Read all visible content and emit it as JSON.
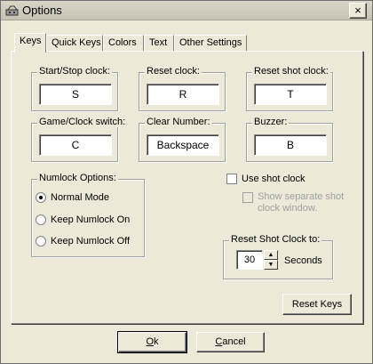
{
  "window": {
    "title": "Options",
    "close_glyph": "×",
    "icon": "options-icon"
  },
  "tabs": [
    {
      "label": "Keys",
      "active": true
    },
    {
      "label": "Quick Keys",
      "active": false
    },
    {
      "label": "Colors",
      "active": false
    },
    {
      "label": "Text",
      "active": false
    },
    {
      "label": "Other Settings",
      "active": false
    }
  ],
  "keys": {
    "start_stop": {
      "label": "Start/Stop clock:",
      "value": "S"
    },
    "reset_clock": {
      "label": "Reset clock:",
      "value": "R"
    },
    "reset_shot": {
      "label": "Reset shot clock:",
      "value": "T"
    },
    "game_clock": {
      "label": "Game/Clock switch:",
      "value": "C"
    },
    "clear_number": {
      "label": "Clear Number:",
      "value": "Backspace"
    },
    "buzzer": {
      "label": "Buzzer:",
      "value": "B"
    }
  },
  "numlock": {
    "label": "Numlock Options:",
    "options": [
      {
        "label": "Normal Mode",
        "selected": true
      },
      {
        "label": "Keep Numlock On",
        "selected": false
      },
      {
        "label": "Keep Numlock Off",
        "selected": false
      }
    ]
  },
  "shot_clock": {
    "use_label": "Use shot clock",
    "show_separate_line1": "Show separate shot",
    "show_separate_line2": "clock window."
  },
  "reset_shot_to": {
    "label": "Reset Shot Clock to:",
    "value": "30",
    "unit": "Seconds",
    "up_glyph": "▲",
    "down_glyph": "▼"
  },
  "buttons": {
    "reset_keys": "Reset Keys",
    "ok_hotkey": "O",
    "ok_rest": "k",
    "cancel_hotkey": "C",
    "cancel_rest": "ancel"
  },
  "colors": {
    "window_bg": "#ece9d8",
    "disabled_text": "#a0a0a0"
  }
}
